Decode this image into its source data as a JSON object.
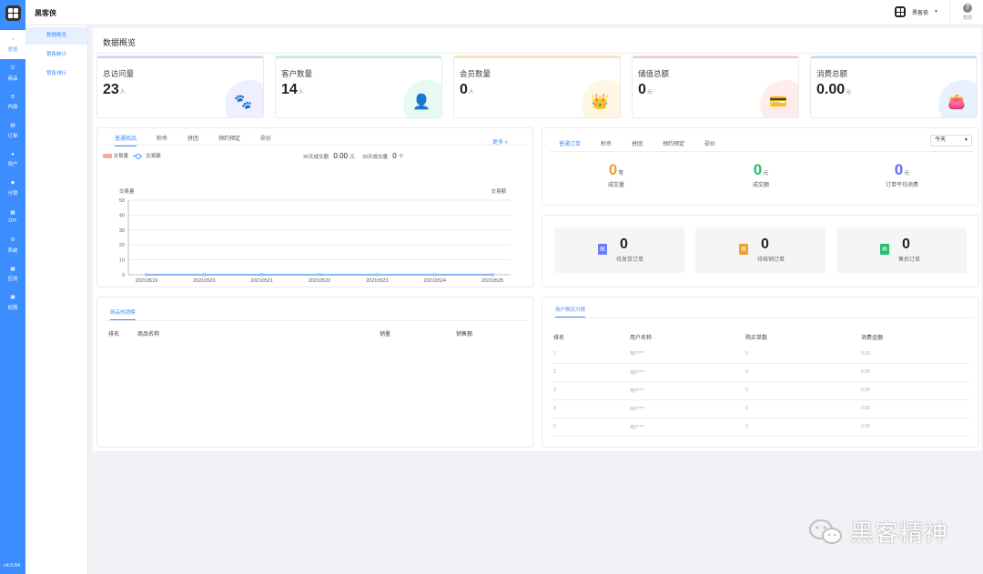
{
  "app": {
    "title": "黑客侠",
    "version": "v4.0.84"
  },
  "header": {
    "user_name": "黑客侠",
    "help_label": "帮助"
  },
  "sidebar": {
    "items": [
      {
        "label": "总览",
        "icon": "pie-chart-icon",
        "active": true
      },
      {
        "label": "商品",
        "icon": "check-square-icon"
      },
      {
        "label": "内容",
        "icon": "list-icon"
      },
      {
        "label": "订单",
        "icon": "document-icon"
      },
      {
        "label": "用户",
        "icon": "user-icon"
      },
      {
        "label": "分销",
        "icon": "users-icon"
      },
      {
        "label": "DIY",
        "icon": "layout-icon"
      },
      {
        "label": "系统",
        "icon": "gear-icon"
      },
      {
        "label": "应用",
        "icon": "grid-icon"
      },
      {
        "label": "权限",
        "icon": "lock-icon"
      }
    ]
  },
  "subnav": {
    "items": [
      {
        "label": "数据概览"
      },
      {
        "label": "销售统计"
      },
      {
        "label": "销售排行"
      }
    ]
  },
  "page": {
    "title": "数据概览"
  },
  "stats": [
    {
      "label": "总访问量",
      "value": "23",
      "unit": "人",
      "color": "#c8cfff",
      "circle": "#eef0ff",
      "icon": "paw-icon",
      "glyph": "🐾"
    },
    {
      "label": "客户数量",
      "value": "14",
      "unit": "人",
      "color": "#b8f0d8",
      "circle": "#e7faf1",
      "icon": "user-search-icon",
      "glyph": "👤"
    },
    {
      "label": "会员数量",
      "value": "0",
      "unit": "人",
      "color": "#ffe2a6",
      "circle": "#fff6e3",
      "icon": "crown-icon",
      "glyph": "👑"
    },
    {
      "label": "储值总额",
      "value": "0",
      "unit": "元",
      "color": "#ffc1c1",
      "circle": "#ffeded",
      "icon": "card-icon",
      "glyph": "💳"
    },
    {
      "label": "消费总额",
      "value": "0.00",
      "unit": "元",
      "color": "#b8d8ff",
      "circle": "#e8f2ff",
      "icon": "wallet-icon",
      "glyph": "👛"
    }
  ],
  "goods_panel": {
    "tabs": [
      "普通商品",
      "秒杀",
      "拼团",
      "预约预定",
      "砍价"
    ],
    "more": "更多 »",
    "legend_a": "交易量",
    "legend_b": "交易额",
    "recent_label": "30天成交额",
    "recent_value": "0.00",
    "recent_unit": "元",
    "recent_count_label": "30天成交量",
    "recent_count": "0",
    "recent_count_unit": "个"
  },
  "chart_data": {
    "type": "line",
    "x": [
      "20210519",
      "20210520",
      "20210521",
      "20210522",
      "20210523",
      "20210524",
      "20210525"
    ],
    "series": [
      {
        "name": "交易量",
        "values": [
          0,
          0,
          0,
          0,
          0,
          0,
          0
        ]
      },
      {
        "name": "交易额",
        "values": [
          0,
          0,
          0,
          0,
          0,
          0,
          0
        ]
      }
    ],
    "ylabel": "交易量",
    "y2label": "交易额",
    "ylim": [
      0,
      50
    ],
    "yticks": [
      "50",
      "40",
      "30",
      "20",
      "10",
      "0"
    ],
    "grid": true
  },
  "orders_panel": {
    "tabs": [
      "普通订单",
      "秒杀",
      "拼团",
      "预约预定",
      "砍价"
    ],
    "period": "今天",
    "stats": [
      {
        "value": "0",
        "unit": "笔",
        "label": "成交量",
        "color": "#f0a030"
      },
      {
        "value": "0",
        "unit": "元",
        "label": "成交额",
        "color": "#22c06a"
      },
      {
        "value": "0",
        "unit": "元",
        "label": "订单平均消费",
        "color": "#5b6bff"
      }
    ]
  },
  "order_status": [
    {
      "value": "0",
      "label": "待发货订单",
      "color": "#6b7bff",
      "icon": "clipboard-icon"
    },
    {
      "value": "0",
      "label": "待核销订单",
      "color": "#f0a030",
      "icon": "ticket-icon"
    },
    {
      "value": "0",
      "label": "售后订单",
      "color": "#22c06a",
      "icon": "return-icon"
    }
  ],
  "hot_goods": {
    "tab": "商品热销榜",
    "columns": [
      "排名",
      "商品名称",
      "销量",
      "销售额"
    ]
  },
  "user_rank": {
    "tab": "用户购买力榜",
    "columns": [
      "排名",
      "用户名称",
      "购买单数",
      "消费金额"
    ],
    "rows": [
      [
        "1",
        "用户***",
        "0",
        "0.00"
      ],
      [
        "2",
        "用户***",
        "0",
        "0.00"
      ],
      [
        "3",
        "用户***",
        "0",
        "0.00"
      ],
      [
        "4",
        "用户***",
        "0",
        "0.00"
      ],
      [
        "5",
        "用户***",
        "0",
        "0.00"
      ]
    ]
  },
  "watermark": {
    "text": "黑客精神"
  }
}
